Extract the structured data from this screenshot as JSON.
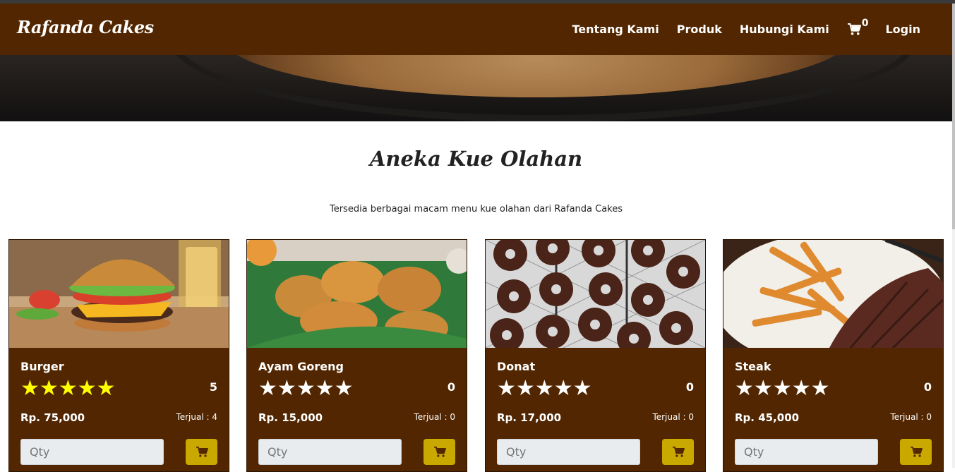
{
  "navbar": {
    "brand": "Rafanda Cakes",
    "links": [
      "Tentang Kami",
      "Produk",
      "Hubungi Kami"
    ],
    "cart_count": "0",
    "login": "Login",
    "bg_color": "#522600"
  },
  "section": {
    "title": "Aneka Kue Olahan",
    "subtitle": "Tersedia berbagai macam menu kue olahan dari Rafanda Cakes"
  },
  "products": [
    {
      "name": "Burger",
      "rating": 5,
      "rating_count": "5",
      "price": "Rp. 75,000",
      "sold": "Terjual : 4",
      "qty_placeholder": "Qty",
      "image": "burger-image"
    },
    {
      "name": "Ayam Goreng",
      "rating": 0,
      "rating_count": "0",
      "price": "Rp. 15,000",
      "sold": "Terjual : 0",
      "qty_placeholder": "Qty",
      "image": "fried-chicken-image"
    },
    {
      "name": "Donat",
      "rating": 0,
      "rating_count": "0",
      "price": "Rp. 17,000",
      "sold": "Terjual : 0",
      "qty_placeholder": "Qty",
      "image": "donut-image"
    },
    {
      "name": "Steak",
      "rating": 0,
      "rating_count": "0",
      "price": "Rp. 45,000",
      "sold": "Terjual : 0",
      "qty_placeholder": "Qty",
      "image": "steak-image"
    }
  ],
  "colors": {
    "card_bg": "#522600",
    "star_filled": "#ffff00",
    "star_empty": "#ffffff",
    "cart_button": "#c9a800"
  }
}
